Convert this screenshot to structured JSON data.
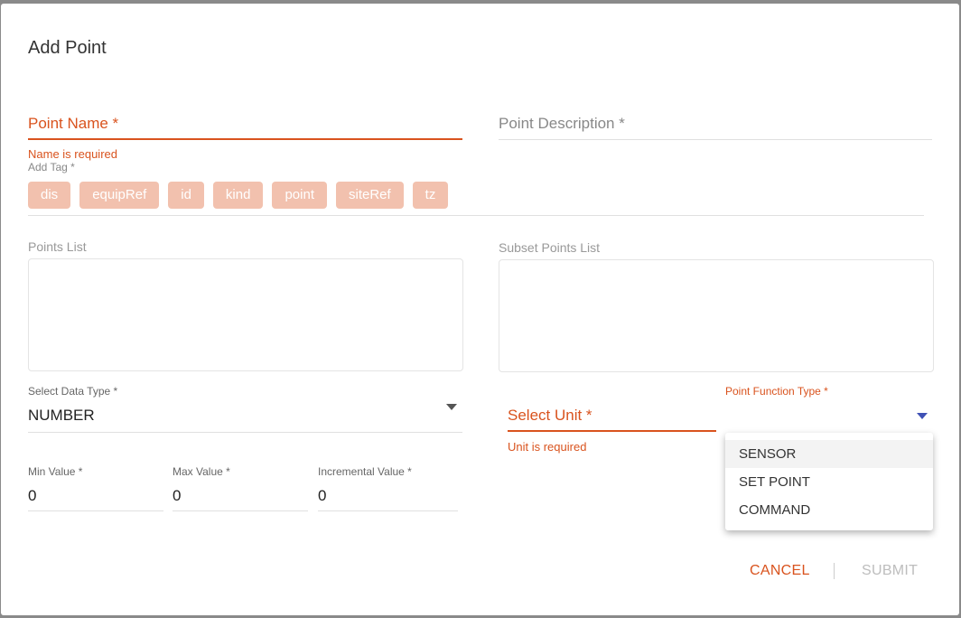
{
  "dialog": {
    "title": "Add Point",
    "point_name": {
      "label": "Point Name *",
      "error": "Name is required"
    },
    "point_description": {
      "label": "Point Description *"
    },
    "tags": {
      "label": "Add Tag *",
      "items": [
        "dis",
        "equipRef",
        "id",
        "kind",
        "point",
        "siteRef",
        "tz"
      ]
    },
    "points_list": {
      "label": "Points List"
    },
    "subset_points_list": {
      "label": "Subset Points List"
    },
    "data_type": {
      "label": "Select Data Type *",
      "value": "NUMBER"
    },
    "unit": {
      "label": "Select Unit *",
      "error": "Unit is required"
    },
    "function_type": {
      "label": "Point Function Type *",
      "options": [
        "SENSOR",
        "SET POINT",
        "COMMAND"
      ]
    },
    "min_value": {
      "label": "Min Value *",
      "value": "0"
    },
    "max_value": {
      "label": "Max Value *",
      "value": "0"
    },
    "incremental_value": {
      "label": "Incremental Value *",
      "value": "0"
    },
    "actions": {
      "cancel": "CANCEL",
      "submit": "SUBMIT"
    }
  },
  "colors": {
    "accent": "#d9531e",
    "tag_bg": "#f2c1ae",
    "dropdown_caret": "#3f51b5"
  }
}
